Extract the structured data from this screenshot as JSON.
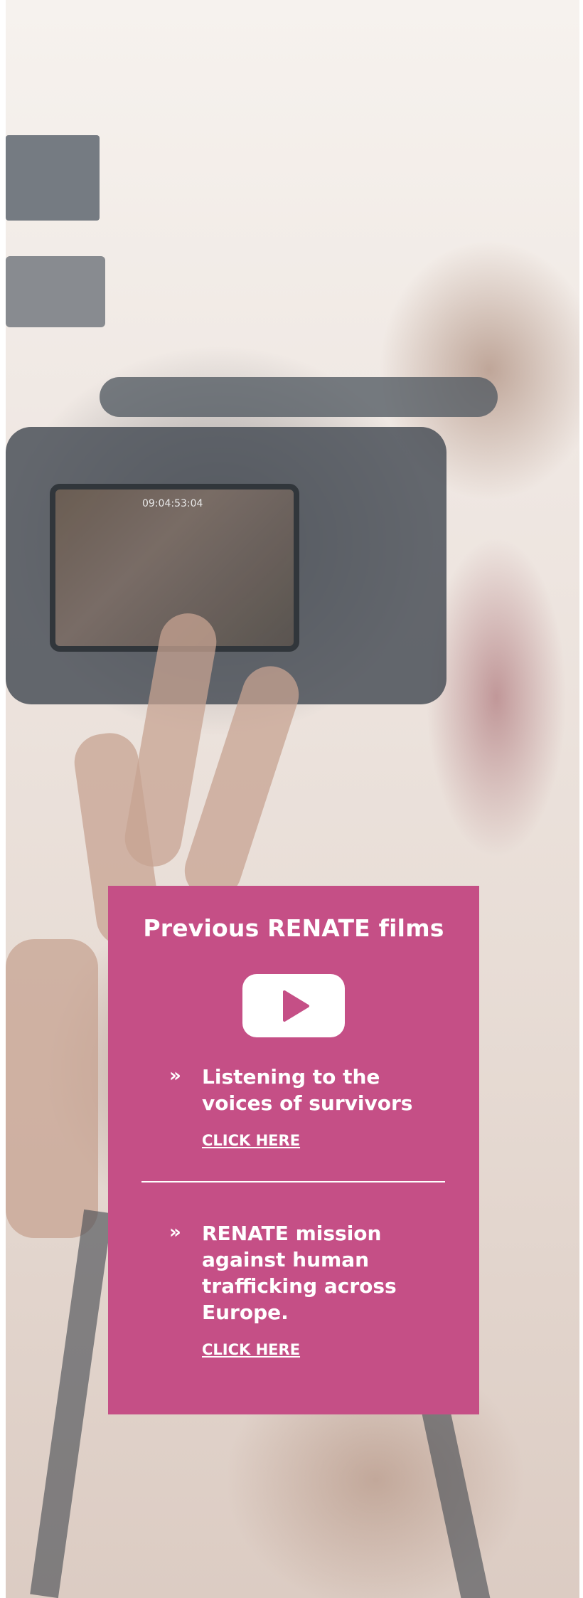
{
  "card": {
    "title": "Previous RENATE films",
    "play_icon": "play-icon",
    "items": [
      {
        "arrow": "»",
        "title": "Listening to the voices of survivors",
        "link_label": "CLICK HERE"
      },
      {
        "arrow": "»",
        "title": "RENATE mission against human trafficking across Europe.",
        "link_label": "CLICK HERE"
      }
    ]
  },
  "background": {
    "camera_screen_text": "09:04:53:04"
  },
  "colors": {
    "card_background": "#c54f86",
    "text": "#ffffff"
  }
}
